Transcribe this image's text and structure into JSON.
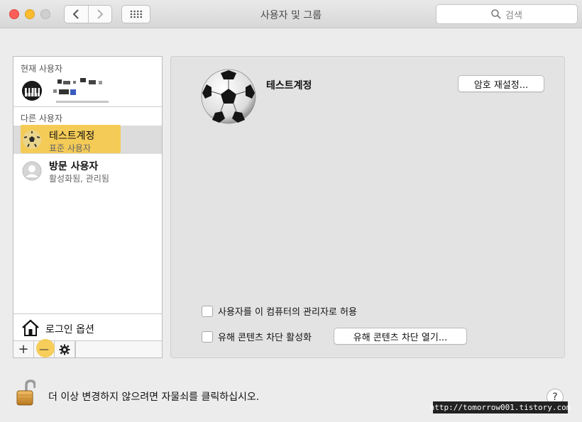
{
  "window": {
    "title": "사용자 및 그룹",
    "search_placeholder": "검색"
  },
  "sidebar": {
    "current_user_header": "현재 사용자",
    "other_users_header": "다른 사용자",
    "users": [
      {
        "name": "테스트계정",
        "role": "표준 사용자",
        "selected": true
      },
      {
        "name": "방문 사용자",
        "role": "활성화됨, 관리됨",
        "selected": false
      }
    ],
    "login_options_label": "로그인 옵션",
    "toolbar": {
      "add": "+",
      "remove": "—"
    }
  },
  "detail": {
    "account_name": "테스트계정",
    "reset_password_button": "암호 재설정...",
    "allow_admin_label": "사용자를 이 컴퓨터의 관리자로 허용",
    "allow_admin_checked": false,
    "parental_controls_label": "유해 콘텐츠 차단 활성화",
    "parental_controls_checked": false,
    "open_parental_controls_button": "유해 콘텐츠 차단 열기..."
  },
  "footer": {
    "lock_text": "더 이상 변경하지 않으려면 자물쇠를 클릭하십시오.",
    "help": "?",
    "watermark": "http://tomorrow001.tistory.com"
  },
  "colors": {
    "highlight": "#f6c948",
    "window_bg": "#ececec",
    "panel_bg": "#e3e3e3"
  }
}
